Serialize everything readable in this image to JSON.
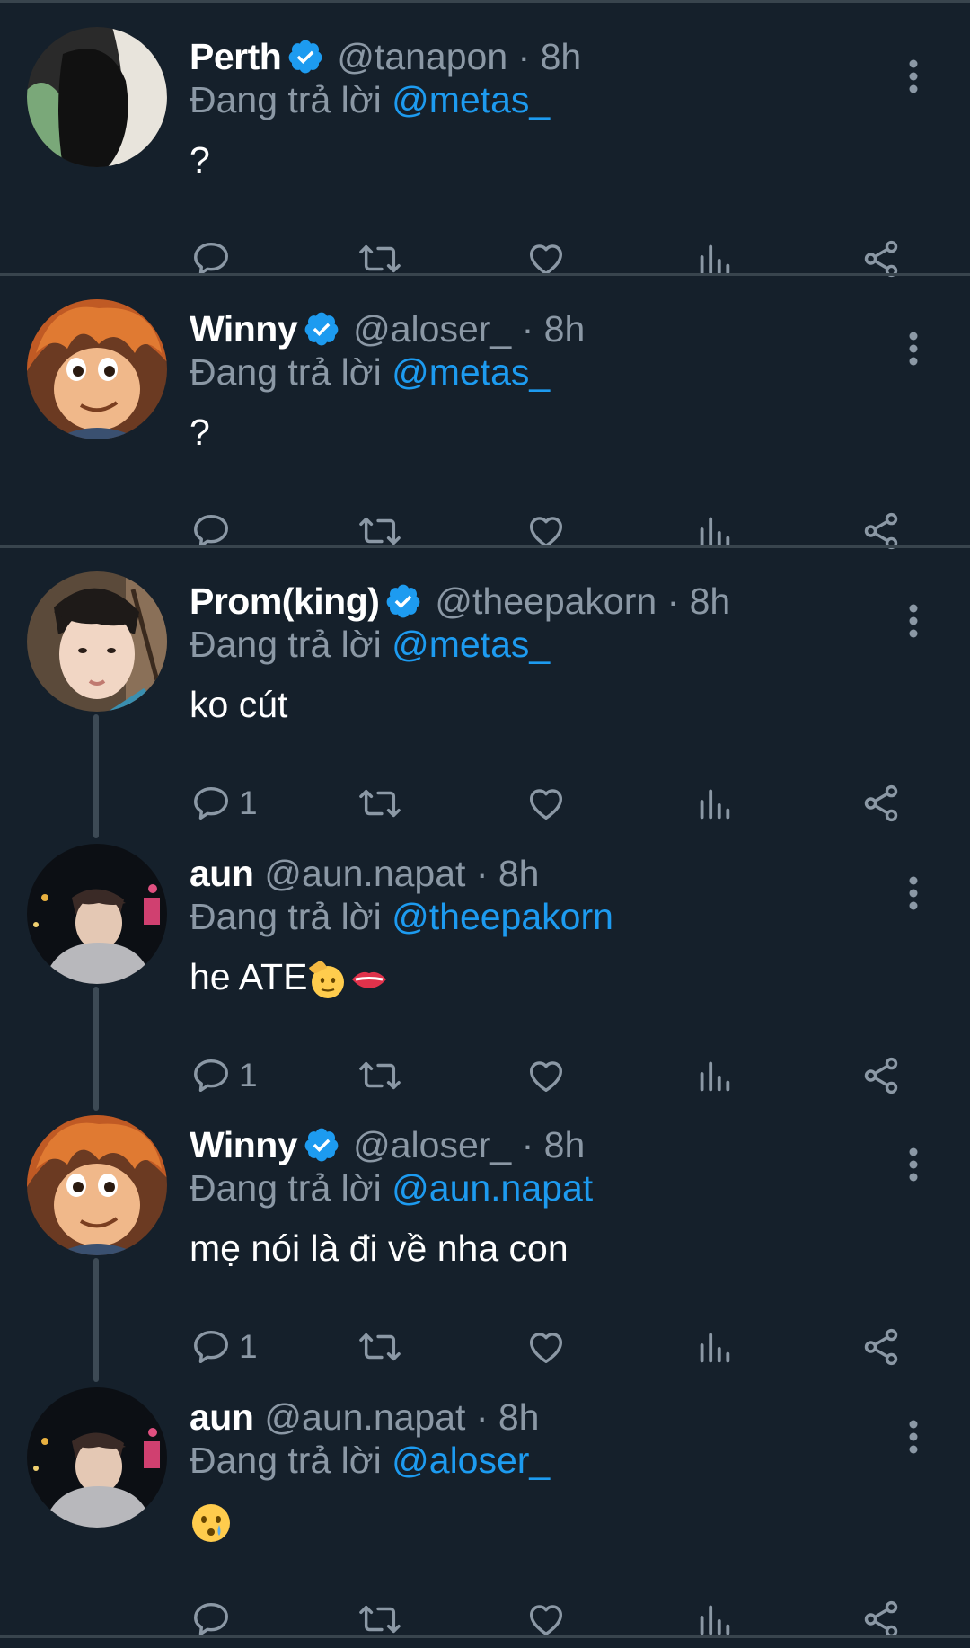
{
  "colors": {
    "background": "#15202b",
    "separator": "#38444d",
    "name": "#ffffff",
    "muted": "#8b98a5",
    "mention": "#1d9bf0",
    "verified": "#1d9bf0"
  },
  "icons": [
    "reply-icon",
    "retweet-icon",
    "like-icon",
    "views-icon",
    "share-icon",
    "more-options-icon",
    "verified-badge-icon"
  ],
  "tweets": [
    {
      "name": "Perth",
      "verified": true,
      "handle": "@tanapon · 8h",
      "reply_prefix": "Đang trả lời ",
      "reply_to": "@metas_",
      "text": "?",
      "reply_count": ""
    },
    {
      "name": "Winny",
      "verified": true,
      "handle": "@aloser_ · 8h",
      "reply_prefix": "Đang trả lời ",
      "reply_to": "@metas_",
      "text": "?",
      "reply_count": ""
    },
    {
      "name": "Prom(king)",
      "verified": true,
      "handle": "@theepakorn · 8h",
      "reply_prefix": "Đang trả lời ",
      "reply_to": "@metas_",
      "text": "ko cút",
      "reply_count": "1"
    },
    {
      "name": "aun",
      "verified": false,
      "handle": "@aun.napat · 8h",
      "reply_prefix": "Đang trả lời ",
      "reply_to": "@theepakorn",
      "text": "he ATE",
      "reply_count": "1"
    },
    {
      "name": "Winny",
      "verified": true,
      "handle": "@aloser_ · 8h",
      "reply_prefix": "Đang trả lời ",
      "reply_to": "@aun.napat",
      "text": "mẹ nói là đi về nha con",
      "reply_count": "1"
    },
    {
      "name": "aun",
      "verified": false,
      "handle": "@aun.napat · 8h",
      "reply_prefix": "Đang trả lời ",
      "reply_to": "@aloser_",
      "text": "",
      "reply_count": ""
    }
  ]
}
